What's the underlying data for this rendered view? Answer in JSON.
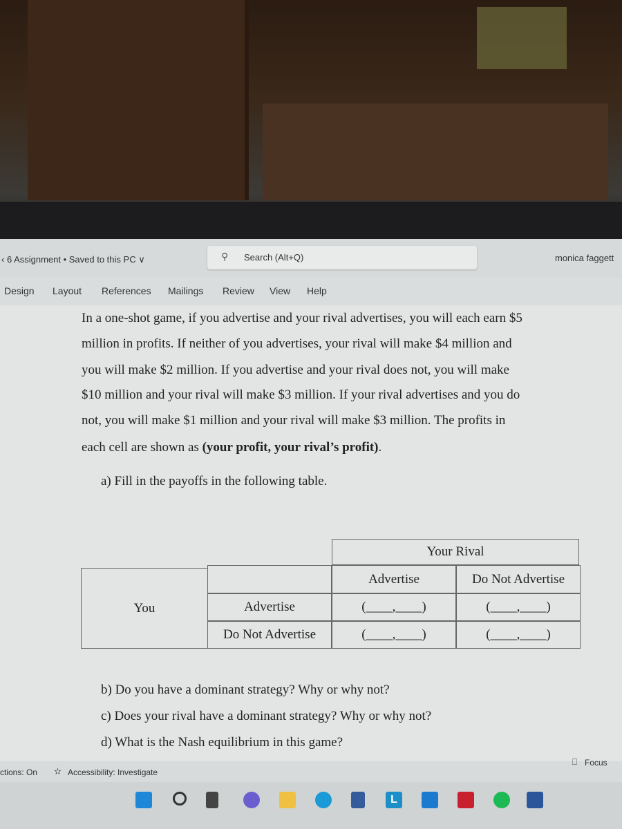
{
  "titlebar": {
    "doc_title": "‹ 6 Assignment • Saved to this PC ∨",
    "search_placeholder": "Search (Alt+Q)",
    "user": "monica faggett"
  },
  "ribbon": {
    "tabs": [
      "Design",
      "Layout",
      "References",
      "Mailings",
      "Review",
      "View",
      "Help"
    ]
  },
  "document": {
    "paragraph_lines": [
      "In a one-shot game, if you advertise and your rival advertises, you will each earn $5",
      "million in profits. If neither of you advertises, your rival will make $4 million and",
      "you will make $2 million. If you advertise and your rival does not, you will make",
      "$10 million and your rival will make $3 million. If your rival advertises and you do",
      "not, you will make $1 million and your rival will make $3 million. The profits in"
    ],
    "last_line_prefix": "each cell are shown as ",
    "last_line_bold": "(your profit, your rival’s profit)",
    "last_line_suffix": ".",
    "question_a": "a) Fill in the payoffs in the following table.",
    "table": {
      "rival_header": "Your Rival",
      "player": "You",
      "rival_strategies": [
        "Advertise",
        "Do Not Advertise"
      ],
      "your_strategies": [
        "Advertise",
        "Do Not Advertise"
      ],
      "blank_cell": "(____,____)"
    },
    "question_b": "b) Do you have a dominant strategy? Why or why not?",
    "question_c": "c) Does your rival have a dominant strategy? Why or why not?",
    "question_d": "d) What is the Nash equilibrium in this game?"
  },
  "statusbar": {
    "predictions": "ctions: On",
    "accessibility": "Accessibility: Investigate",
    "focus": "Focus"
  },
  "taskbar": {
    "icons": [
      "windows-start-icon",
      "search-icon",
      "task-view-icon",
      "teams-chat-icon",
      "file-explorer-icon",
      "edge-icon",
      "microsoft-store-icon",
      "l-app-icon",
      "cortana-icon",
      "mcafee-icon",
      "spotify-icon",
      "word-icon"
    ]
  }
}
